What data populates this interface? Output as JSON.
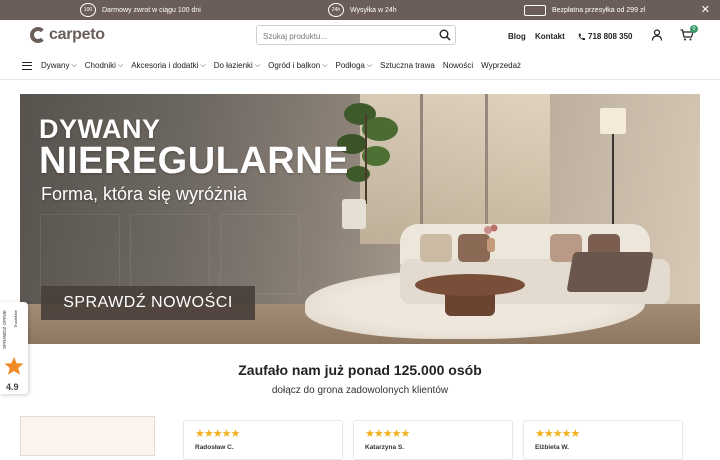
{
  "topbar": {
    "items": [
      {
        "icon": "return-icon",
        "icon_text": "100",
        "label": "Darmowy zwrot w ciągu 100 dni"
      },
      {
        "icon": "delivery-icon",
        "icon_text": "24h",
        "label": "Wysyłka w 24h"
      },
      {
        "icon": "truck-icon",
        "icon_text": "",
        "label": "Bezpłatna przesyłka od 299 zł"
      }
    ],
    "close_label": "✕"
  },
  "header": {
    "logo_text": "carpeto",
    "search_placeholder": "Szukaj produktu...",
    "links": {
      "blog": "Blog",
      "contact": "Kontakt"
    },
    "phone": "718 808 350",
    "cart_count": "0"
  },
  "nav": {
    "items": [
      {
        "label": "Dywany",
        "dropdown": true
      },
      {
        "label": "Chodniki",
        "dropdown": true
      },
      {
        "label": "Akcesoria i dodatki",
        "dropdown": true
      },
      {
        "label": "Do łazienki",
        "dropdown": true
      },
      {
        "label": "Ogród i balkon",
        "dropdown": true
      },
      {
        "label": "Podłoga",
        "dropdown": true
      },
      {
        "label": "Sztuczna trawa",
        "dropdown": false
      },
      {
        "label": "Nowości",
        "dropdown": false
      },
      {
        "label": "Wyprzedaż",
        "dropdown": false
      }
    ]
  },
  "hero": {
    "line1": "DYWANY",
    "line2": "NIEREGULARNE",
    "line3": "Forma, która się wyróżnia",
    "cta": "SPRAWDŹ NOWOŚCI"
  },
  "trust_widget": {
    "label": "SPRAWDŹ OPINIE",
    "brand": "TrustMate",
    "score": "4.9"
  },
  "trust_section": {
    "title": "Zaufało nam już ponad 125.000 osób",
    "subtitle": "dołącz do grona zadowolonych klientów",
    "reviews": [
      {
        "stars": "★★★★★",
        "name": "Radosław C."
      },
      {
        "stars": "★★★★★",
        "name": "Katarzyna S."
      },
      {
        "stars": "★★★★★",
        "name": "Elżbieta W."
      }
    ]
  },
  "colors": {
    "topbar": "#6b5e59",
    "brand": "#6b5e59",
    "star": "#f2b01e",
    "cart_badge": "#3a9b6a"
  }
}
